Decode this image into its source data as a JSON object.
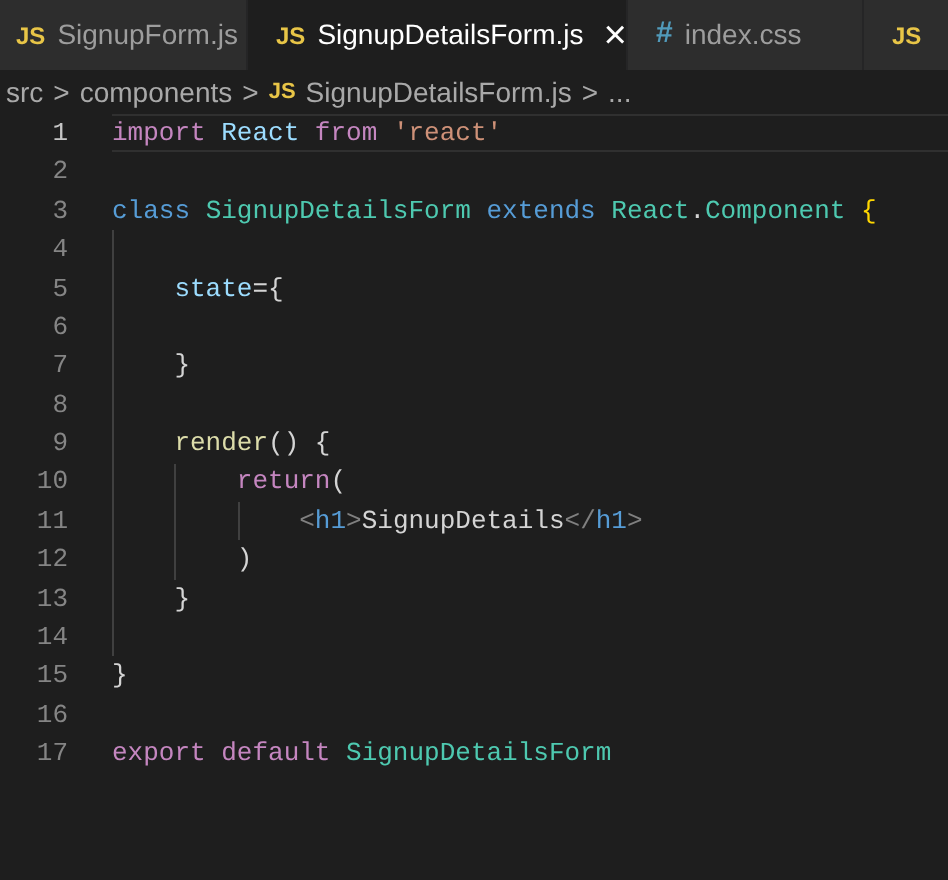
{
  "tabs": [
    {
      "icon": "JS",
      "kind": "js",
      "label": "SignupForm.js",
      "selected": false
    },
    {
      "icon": "JS",
      "kind": "js",
      "label": "SignupDetailsForm.js",
      "selected": true,
      "close": "×"
    },
    {
      "icon": "#",
      "kind": "css",
      "label": "index.css",
      "selected": false
    },
    {
      "icon": "JS",
      "kind": "js",
      "selected": false
    }
  ],
  "breadcrumb": [
    {
      "text": "src"
    },
    {
      "text": "components"
    },
    {
      "icon": "JS",
      "text": "SignupDetailsForm.js"
    },
    {
      "text": "..."
    }
  ],
  "breadcrumb_separator": ">",
  "editor": {
    "lines": [
      {
        "number": "1",
        "current": true,
        "tokens": [
          {
            "kind": "keyword",
            "text": "import "
          },
          {
            "kind": "variable",
            "text": "React "
          },
          {
            "kind": "keyword",
            "text": "from "
          },
          {
            "kind": "string",
            "text": "'react'"
          }
        ]
      },
      {
        "number": "2",
        "current": false
      },
      {
        "number": "3",
        "current": false,
        "tokens": [
          {
            "kind": "storage",
            "text": "class "
          },
          {
            "kind": "type",
            "text": "SignupDetailsForm "
          },
          {
            "kind": "storage",
            "text": "extends "
          },
          {
            "kind": "type",
            "text": "React"
          },
          {
            "kind": "plain",
            "text": "."
          },
          {
            "kind": "type",
            "text": "Component "
          },
          {
            "kind": "bracket",
            "text": "{"
          }
        ]
      },
      {
        "number": "4",
        "current": false
      },
      {
        "number": "5",
        "current": false,
        "tokens": [
          {
            "kind": "variable",
            "text": "    state"
          },
          {
            "kind": "plain",
            "text": "={"
          }
        ]
      },
      {
        "number": "6",
        "current": false
      },
      {
        "number": "7",
        "current": false,
        "tokens": [
          {
            "kind": "plain",
            "text": "    }"
          }
        ]
      },
      {
        "number": "8",
        "current": false
      },
      {
        "number": "9",
        "current": false,
        "tokens": [
          {
            "kind": "function",
            "text": "    render"
          },
          {
            "kind": "plain",
            "text": "() {"
          }
        ]
      },
      {
        "number": "10",
        "current": false,
        "tokens": [
          {
            "kind": "keyword",
            "text": "        return"
          },
          {
            "kind": "plain",
            "text": "("
          }
        ]
      },
      {
        "number": "11",
        "current": false,
        "tokens": [
          {
            "kind": "angle",
            "text": "            <"
          },
          {
            "kind": "tag",
            "text": "h1"
          },
          {
            "kind": "angle",
            "text": ">"
          },
          {
            "kind": "plain",
            "text": "SignupDetails"
          },
          {
            "kind": "angle",
            "text": "</"
          },
          {
            "kind": "tag",
            "text": "h1"
          },
          {
            "kind": "angle",
            "text": ">"
          }
        ]
      },
      {
        "number": "12",
        "current": false,
        "tokens": [
          {
            "kind": "plain",
            "text": "        )"
          }
        ]
      },
      {
        "number": "13",
        "current": false,
        "tokens": [
          {
            "kind": "plain",
            "text": "    }"
          }
        ]
      },
      {
        "number": "14",
        "current": false
      },
      {
        "number": "15",
        "current": false,
        "tokens": [
          {
            "kind": "plain",
            "text": "}"
          }
        ]
      },
      {
        "number": "16",
        "current": false
      },
      {
        "number": "17",
        "current": false,
        "tokens": [
          {
            "kind": "keyword",
            "text": "export default "
          },
          {
            "kind": "type",
            "text": "SignupDetailsForm"
          }
        ]
      }
    ]
  }
}
